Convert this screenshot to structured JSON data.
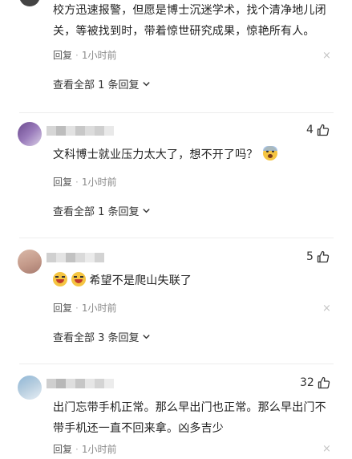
{
  "comments": [
    {
      "text": "校方迅速报警，但愿是博士沉迷学术，找个清净地儿闭关，等被找到时，带着惊世研究成果，惊艳所有人。",
      "reply_label": "回复",
      "time": "1小时前",
      "view_replies": "查看全部 1 条回复",
      "likes": ""
    },
    {
      "text": "文科博士就业压力太大了，想不开了吗？",
      "reply_label": "回复",
      "time": "1小时前",
      "view_replies": "查看全部 1 条回复",
      "likes": "4"
    },
    {
      "text": "希望不是爬山失联了",
      "reply_label": "回复",
      "time": "1小时前",
      "view_replies": "查看全部 3 条回复",
      "likes": "5"
    },
    {
      "text": "出门忘带手机正常。那么早出门也正常。那么早出门不带手机还一直不回来拿。凶多吉少",
      "reply_label": "回复",
      "time": "1小时前",
      "view_replies": "",
      "likes": "32"
    }
  ],
  "icons": {
    "thumb": "thumb-up-icon",
    "chevron": "chevron-down-icon",
    "close": "close-icon",
    "emoji_scared": "scared-face-emoji",
    "emoji_laugh": "laughing-face-emoji"
  },
  "close_glyph": "×",
  "dot_glyph": "·"
}
